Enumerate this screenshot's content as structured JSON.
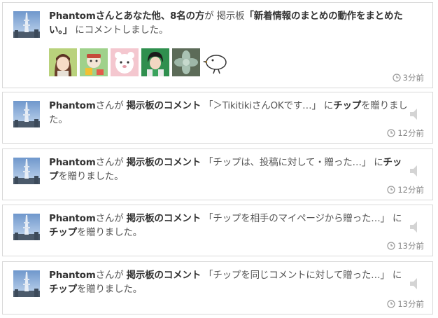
{
  "notifications": [
    {
      "title_user": "Phantomさんとあなた他、8名の方",
      "title_particle": "が",
      "board_label": "掲示板",
      "quote_open": "「",
      "post_title": "新着情報のまとめの動作をまとめたい。",
      "quote_close": "」",
      "action": "にコメントしました。",
      "time": "3分前",
      "avatars": [
        "anime-girl-avatar",
        "shopping-character-avatar",
        "bear-avatar",
        "green-anime-avatar",
        "succulent-avatar",
        "bird-avatar"
      ]
    },
    {
      "user": "Phantom",
      "user_suffix": "さんが",
      "source": "掲示板のコメント",
      "quote": "「＞TikitikiさんOKです…」",
      "particle": "に",
      "object": "チップ",
      "action": "を贈りました。",
      "time": "12分前"
    },
    {
      "user": "Phantom",
      "user_suffix": "さんが",
      "source": "掲示板のコメント",
      "quote": "「チップは、投稿に対して・贈った…」",
      "particle": "に",
      "object": "チップ",
      "action": "を贈りました。",
      "time": "12分前"
    },
    {
      "user": "Phantom",
      "user_suffix": "さんが",
      "source": "掲示板のコメント",
      "quote": "「チップを相手のマイページから贈った…」",
      "particle": "に",
      "object": "チップ",
      "action": "を贈りました。",
      "time": "13分前"
    },
    {
      "user": "Phantom",
      "user_suffix": "さんが",
      "source": "掲示板のコメント",
      "quote": "「チップを同じコメントに対して贈った…」",
      "particle": "に",
      "object": "チップ",
      "action": "を贈りました。",
      "time": "13分前"
    }
  ]
}
